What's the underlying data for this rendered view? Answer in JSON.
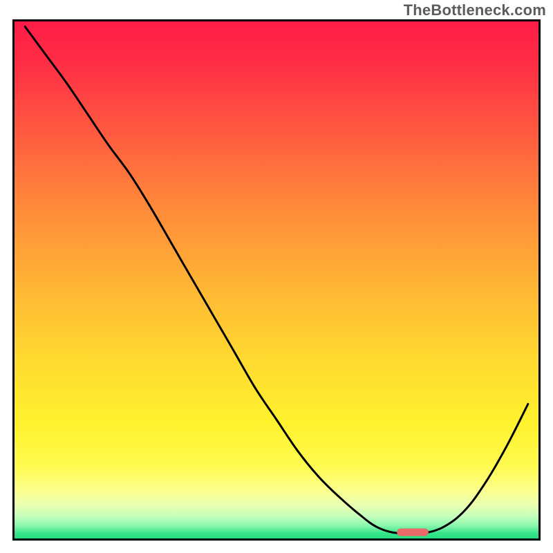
{
  "watermark": "TheBottleneck.com",
  "colors": {
    "frame": "#000000",
    "curve": "#000000",
    "marker_fill": "#ea6a6a",
    "marker_stroke": "#e05555",
    "gradient_stops": [
      {
        "offset": 0.0,
        "color": "#ff1c47"
      },
      {
        "offset": 0.08,
        "color": "#ff2e46"
      },
      {
        "offset": 0.2,
        "color": "#ff5540"
      },
      {
        "offset": 0.35,
        "color": "#ff873a"
      },
      {
        "offset": 0.5,
        "color": "#ffb235"
      },
      {
        "offset": 0.65,
        "color": "#ffd930"
      },
      {
        "offset": 0.78,
        "color": "#fff22e"
      },
      {
        "offset": 0.86,
        "color": "#fffb50"
      },
      {
        "offset": 0.905,
        "color": "#fcff8a"
      },
      {
        "offset": 0.935,
        "color": "#e9ffb0"
      },
      {
        "offset": 0.958,
        "color": "#c3ffbc"
      },
      {
        "offset": 0.975,
        "color": "#8af7ad"
      },
      {
        "offset": 0.99,
        "color": "#35e58a"
      },
      {
        "offset": 1.0,
        "color": "#28dd82"
      }
    ]
  },
  "chart_data": {
    "type": "line",
    "title": "",
    "xlabel": "",
    "ylabel": "",
    "xlim": [
      0,
      100
    ],
    "ylim": [
      0,
      100
    ],
    "grid": false,
    "x": [
      2,
      6,
      10,
      14,
      18,
      22,
      26,
      30,
      34,
      38,
      42,
      46,
      50,
      54,
      58,
      62,
      66,
      69,
      72,
      75,
      78,
      82,
      86,
      90,
      94,
      98
    ],
    "values": [
      99,
      93.5,
      88,
      82,
      76,
      70.5,
      64,
      57,
      50,
      43,
      36,
      29,
      23,
      17,
      12,
      8,
      4.5,
      2.3,
      1.2,
      1.0,
      1.0,
      2.3,
      5.5,
      11,
      18,
      26
    ],
    "marker": {
      "x_start": 73,
      "x_end": 79,
      "y": 1.2
    },
    "annotations": []
  }
}
